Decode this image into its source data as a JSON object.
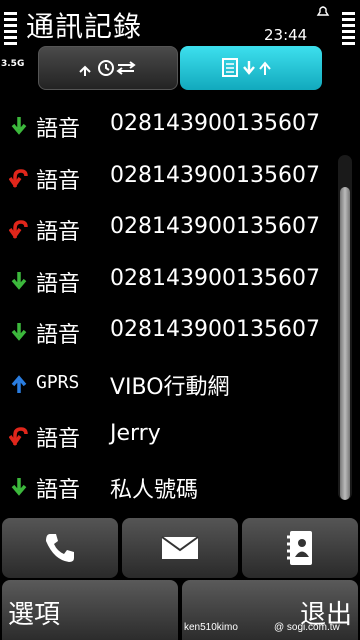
{
  "status": {
    "title": "通訊記錄",
    "time": "23:44",
    "network": "3.5G"
  },
  "tabs": [
    {
      "name": "tab-call-log",
      "active": false,
      "icon": "recent-calls-icon"
    },
    {
      "name": "tab-packet-data",
      "active": true,
      "icon": "data-transfer-icon"
    }
  ],
  "entries": [
    {
      "direction": "incoming",
      "type": "語音",
      "number": "028143900135607"
    },
    {
      "direction": "missed",
      "type": "語音",
      "number": "028143900135607"
    },
    {
      "direction": "missed",
      "type": "語音",
      "number": "028143900135607"
    },
    {
      "direction": "incoming",
      "type": "語音",
      "number": "028143900135607"
    },
    {
      "direction": "incoming",
      "type": "語音",
      "number": "028143900135607"
    },
    {
      "direction": "outgoing",
      "type": "GPRS",
      "number": "VIBO行動網"
    },
    {
      "direction": "missed",
      "type": "語音",
      "number": "Jerry"
    },
    {
      "direction": "incoming",
      "type": "語音",
      "number": "私人號碼"
    }
  ],
  "toolbar": [
    "phone-icon",
    "envelope-icon",
    "contacts-icon"
  ],
  "softkeys": {
    "left": "選項",
    "right": "退出"
  },
  "watermark": {
    "left": "ken510kimo",
    "right": "@ sogi.com.tw"
  },
  "colors": {
    "incoming": "#3cb83c",
    "missed": "#e0261b",
    "outgoing": "#2a7de0",
    "tab_active": "#1fc3d6"
  }
}
